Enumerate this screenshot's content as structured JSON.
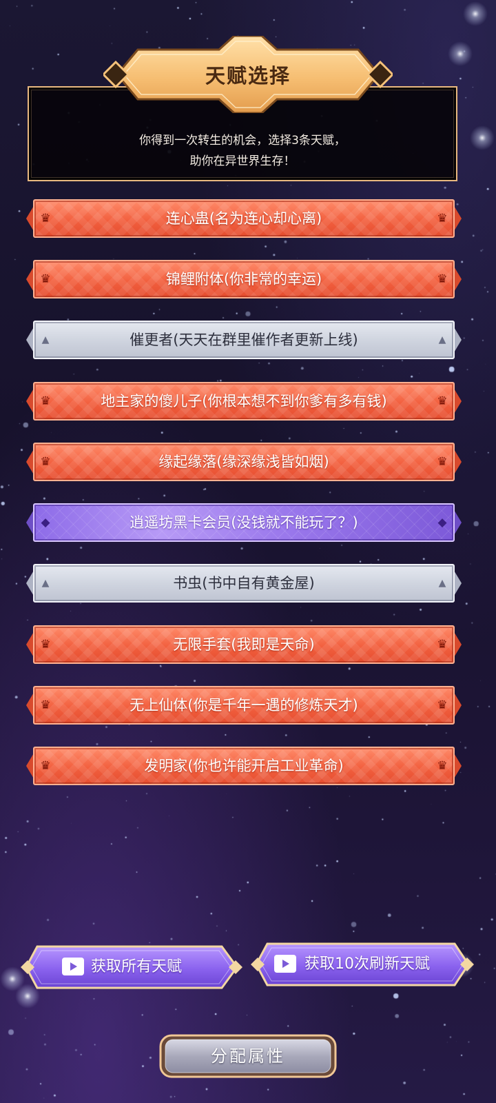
{
  "header": {
    "title": "天赋选择",
    "intro_line1": "你得到一次转生的机会，选择3条天赋，",
    "intro_line2": "助你在异世界生存！"
  },
  "talents": [
    {
      "label": "连心蛊(名为连心却心离)",
      "rarity": "orange",
      "icon": "crown-icon"
    },
    {
      "label": "锦鲤附体(你非常的幸运)",
      "rarity": "orange",
      "icon": "crown-icon"
    },
    {
      "label": "催更者(天天在群里催作者更新上线)",
      "rarity": "grey",
      "icon": "triangle-icon"
    },
    {
      "label": "地主家的傻儿子(你根本想不到你爹有多有钱)",
      "rarity": "orange",
      "icon": "crown-icon"
    },
    {
      "label": "缘起缘落(缘深缘浅皆如烟)",
      "rarity": "orange",
      "icon": "crown-icon"
    },
    {
      "label": "逍遥坊黑卡会员(没钱就不能玩了？)",
      "rarity": "purple",
      "icon": "diamond-icon"
    },
    {
      "label": "书虫(书中自有黄金屋)",
      "rarity": "grey",
      "icon": "triangle-icon"
    },
    {
      "label": "无限手套(我即是天命)",
      "rarity": "orange",
      "icon": "crown-icon"
    },
    {
      "label": "无上仙体(你是千年一遇的修炼天才)",
      "rarity": "orange",
      "icon": "crown-icon"
    },
    {
      "label": "发明家(你也许能开启工业革命)",
      "rarity": "orange",
      "icon": "crown-icon"
    }
  ],
  "buttons": {
    "get_all": "获取所有天赋",
    "refresh": "获取10次刷新天赋",
    "assign": "分配属性"
  },
  "colors": {
    "orange": "#f2603f",
    "grey": "#ced3de",
    "purple": "#9a78ec",
    "gold": "#f5c27a"
  }
}
